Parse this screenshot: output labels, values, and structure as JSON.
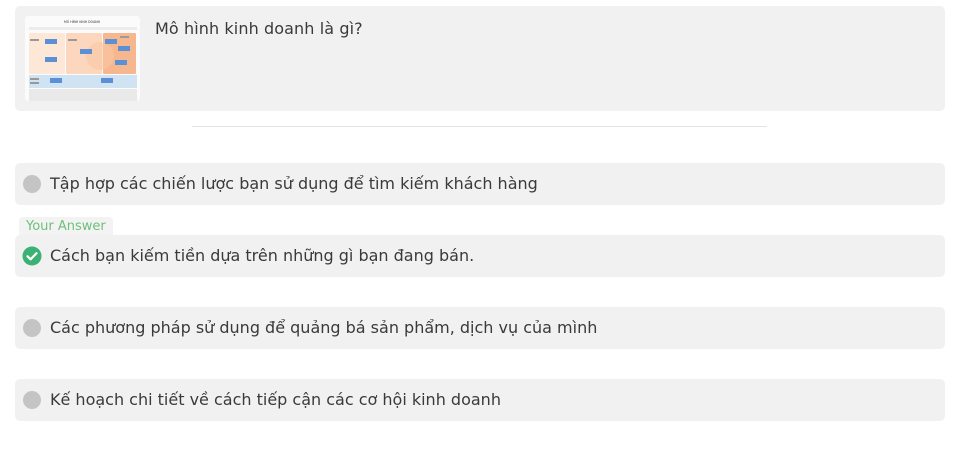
{
  "question": {
    "text": "Mô hình kinh doanh là gì?",
    "thumbnail_title": "MÔ HÌNH KINH DOANH"
  },
  "options": [
    {
      "label": "Tập hợp các chiến lược bạn sử dụng để tìm kiếm khách hàng",
      "selected": false
    },
    {
      "label": "Cách bạn kiếm tiền dựa trên những gì bạn đang bán.",
      "selected": true
    },
    {
      "label": "Các phương pháp sử dụng để quảng bá sản phẩm, dịch vụ của mình",
      "selected": false
    },
    {
      "label": "Kế hoạch chi tiết về cách tiếp cận các cơ hội kinh doanh",
      "selected": false
    }
  ],
  "your_answer_label": "Your Answer",
  "colors": {
    "card_bg": "#f1f1f1",
    "correct_green": "#3bb273",
    "answer_tag_text": "#6ec07a",
    "radio_gray": "#c4c4c4"
  },
  "icons": {
    "selected": "check-circle-icon",
    "unselected": "radio-circle-icon"
  }
}
